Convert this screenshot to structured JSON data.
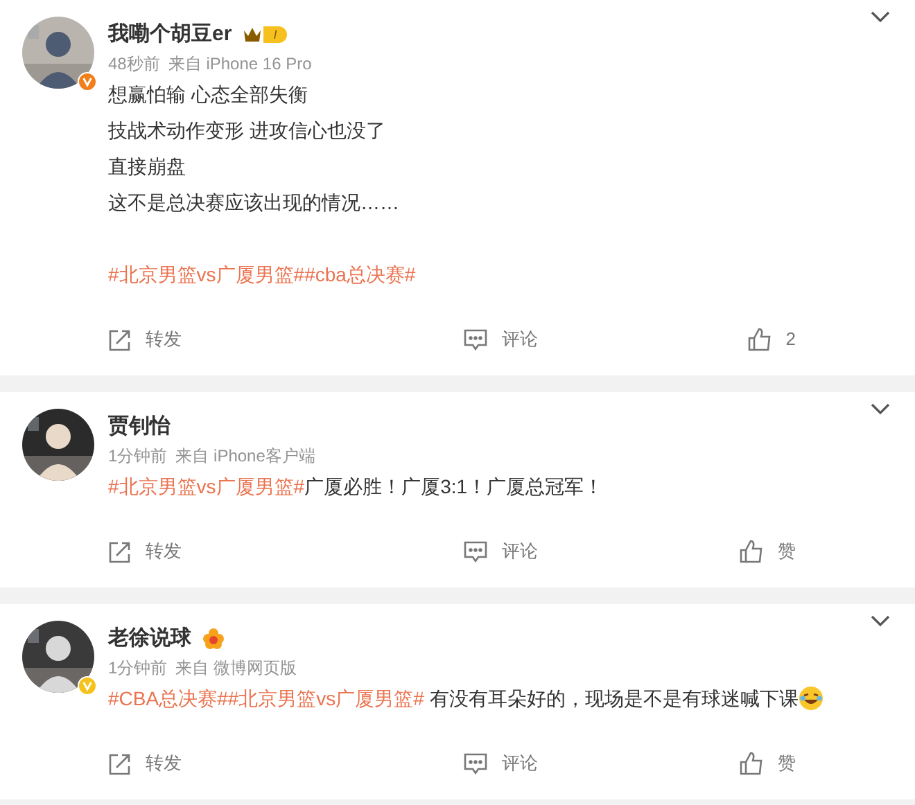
{
  "posts": [
    {
      "avatar": {
        "kind": "picture"
      },
      "name": "我嘞个胡豆er",
      "badge": {
        "kind": "vip",
        "label": "I"
      },
      "verified": {
        "color": "#f07f1c"
      },
      "meta": [
        "48秒前",
        "来自 iPhone 16 Pro"
      ],
      "paragraphs": [
        [
          [
            {
              "kind": "text",
              "text": "想赢怕输 心态全部失衡"
            }
          ],
          [
            {
              "kind": "text",
              "text": "技战术动作变形 进攻信心也没了"
            }
          ],
          [
            {
              "kind": "text",
              "text": "直接崩盘"
            }
          ],
          [
            {
              "kind": "text",
              "text": "这不是总决赛应该出现的情况……"
            }
          ]
        ],
        [
          [
            {
              "kind": "tag",
              "text": "#北京男篮vs广厦男篮#"
            },
            {
              "kind": "tag",
              "text": "#cba总决赛#"
            }
          ]
        ]
      ],
      "actions": [
        {
          "kind": "forward",
          "label": "转发"
        },
        {
          "kind": "comment",
          "label": "评论"
        },
        {
          "kind": "like",
          "label": "2"
        }
      ]
    },
    {
      "avatar": {
        "kind": "picture"
      },
      "name": "贾钊怡",
      "meta": [
        "1分钟前",
        "来自 iPhone客户端"
      ],
      "paragraphs": [
        [
          [
            {
              "kind": "tag",
              "text": "#北京男篮vs广厦男篮#"
            },
            {
              "kind": "text",
              "text": "广厦必胜！广厦3:1！广厦总冠军！"
            }
          ]
        ]
      ],
      "actions": [
        {
          "kind": "forward",
          "label": "转发"
        },
        {
          "kind": "comment",
          "label": "评论"
        },
        {
          "kind": "like",
          "label": "赞"
        }
      ]
    },
    {
      "avatar": {
        "kind": "picture"
      },
      "name": "老徐说球",
      "badge": {
        "kind": "flower"
      },
      "verified": {
        "color": "#f5c21b"
      },
      "meta": [
        "1分钟前",
        "来自 微博网页版"
      ],
      "paragraphs": [
        [
          [
            {
              "kind": "tag",
              "text": "#CBA总决赛#"
            },
            {
              "kind": "tag",
              "text": "#北京男篮vs广厦男篮#"
            },
            {
              "kind": "text",
              "text": " 有没有耳朵好的，现场是不是有球迷喊下课"
            },
            {
              "kind": "emoji"
            }
          ]
        ]
      ],
      "actions": [
        {
          "kind": "forward",
          "label": "转发"
        },
        {
          "kind": "comment",
          "label": "评论"
        },
        {
          "kind": "like",
          "label": "赞"
        }
      ]
    }
  ]
}
